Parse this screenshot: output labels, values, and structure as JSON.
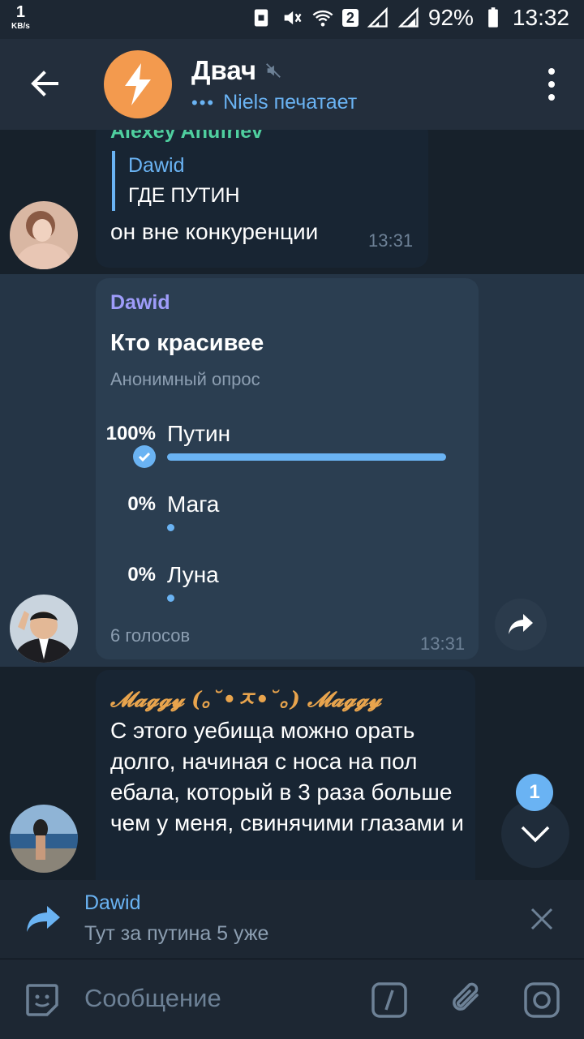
{
  "status_bar": {
    "net_speed": "1",
    "net_unit": "KB/s",
    "sim_badge": "2",
    "battery": "92%",
    "clock": "13:32"
  },
  "header": {
    "chat_title": "Двач",
    "status_dots": "•••",
    "status_text": "Niels печатает"
  },
  "messages": [
    {
      "sender": "Alexey Anufriev",
      "reply_to_name": "Dawid",
      "reply_to_text": "ГДЕ ПУТИН",
      "text": "он вне конкуренции",
      "time": "13:31"
    },
    {
      "sender": "Dawid",
      "poll": {
        "question": "Кто красивее",
        "type": "Анонимный опрос",
        "options": [
          {
            "percent": "100%",
            "label": "Путин",
            "fraction": 1.0,
            "chosen": true
          },
          {
            "percent": "0%",
            "label": "Мага",
            "fraction": 0.0,
            "chosen": false
          },
          {
            "percent": "0%",
            "label": "Луна",
            "fraction": 0.0,
            "chosen": false
          }
        ],
        "votes": "6 голосов"
      },
      "time": "13:31"
    },
    {
      "sender": "𝓜𝓪𝓰𝓰𝔂 (｡˘•ㅈ•˘｡) 𝓜𝓪𝓰𝓰𝔂",
      "text": "С этого уебища можно орать долго, начиная с носа на пол ебала, который в 3 раза больше чем у меня, свинячими глазами и"
    }
  ],
  "unread_count": "1",
  "reply_panel": {
    "name": "Dawid",
    "text": "Тут за путина 5 уже"
  },
  "composer": {
    "placeholder": "Сообщение"
  },
  "colors": {
    "accent": "#6ab3f3",
    "background": "#17212b",
    "bubble": "#182533",
    "poll_bubble": "#2b3e51",
    "avatar_channel": "#f39a4e"
  }
}
